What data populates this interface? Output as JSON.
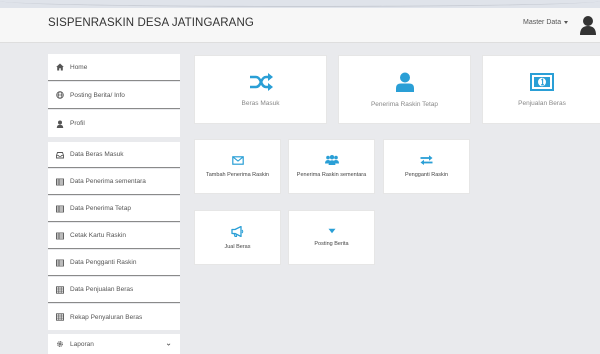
{
  "app": {
    "title": "SISPENRASKIN DESA JATINGARANG"
  },
  "navbar": {
    "menu_label": "Master Data"
  },
  "colors": {
    "accent": "#2a9fd6",
    "background": "#e9eaed"
  },
  "sidebar": {
    "items": [
      {
        "label": "Home",
        "icon": "home-icon"
      },
      {
        "label": "Posting Berita/ Info",
        "icon": "globe-icon"
      },
      {
        "label": "Profil",
        "icon": "user-icon"
      },
      {
        "label": "Data Beras Masuk",
        "icon": "inbox-icon"
      },
      {
        "label": "Data Penerima sementara",
        "icon": "table-icon"
      },
      {
        "label": "Data Penerima Tetap",
        "icon": "table-icon"
      },
      {
        "label": "Cetak Kartu Raskin",
        "icon": "table-icon"
      },
      {
        "label": "Data Pengganti Raskin",
        "icon": "table-icon"
      },
      {
        "label": "Data Penjualan Beras",
        "icon": "grid-icon"
      },
      {
        "label": "Rekap Penyaluran Beras",
        "icon": "grid-icon"
      },
      {
        "label": "Laporan",
        "icon": "gear-icon"
      }
    ]
  },
  "tiles": {
    "row1": [
      {
        "label": "Beras Masuk",
        "icon": "shuffle-icon"
      },
      {
        "label": "Penerima Raskin Tetap",
        "icon": "user-icon"
      },
      {
        "label": "Penjualan Beras",
        "icon": "money-icon"
      }
    ],
    "row2": [
      {
        "label": "Tambah Penerima Raskin",
        "icon": "envelope-icon"
      },
      {
        "label": "Penerima Raskin sementara",
        "icon": "users-icon"
      },
      {
        "label": "Pengganti Raskin",
        "icon": "exchange-icon"
      }
    ],
    "row3": [
      {
        "label": "Jual Beras",
        "icon": "bullhorn-icon"
      },
      {
        "label": "Posting Berita",
        "icon": "caret-down-icon"
      }
    ]
  }
}
